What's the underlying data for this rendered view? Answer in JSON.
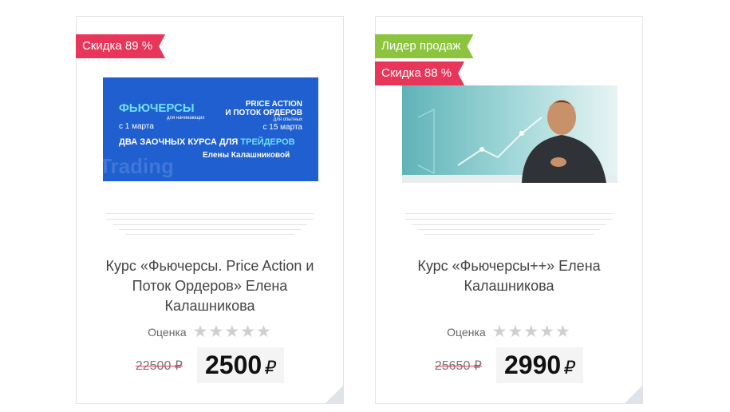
{
  "cards": [
    {
      "badges": [
        "Скидка 89 %"
      ],
      "image_text": {
        "left_title": "ФЬЮЧЕРСЫ",
        "left_sub": "для начинающих",
        "left_date": "с 1 марта",
        "right_title1": "PRICE ACTION",
        "right_title2": "И ПОТОК ОРДЕРОВ",
        "right_sub": "для опытных",
        "right_date": "с 15 марта",
        "headline_a": "ДВА ЗАОЧНЫХ КУРСА ДЛЯ ",
        "headline_b": "ТРЕЙДЕРОВ",
        "author": "Елены Калашниковой",
        "watermark": "Trading"
      },
      "title": "Курс «Фьючерсы. Price Action и Поток Ордеров» Елена Калашникова",
      "rating_label": "Оценка",
      "old_price": "22500 ₽",
      "new_price": "2500",
      "currency": "₽"
    },
    {
      "badges": [
        "Лидер продаж",
        "Скидка 88 %"
      ],
      "title": "Курс «Фьючерсы++» Елена Калашникова",
      "rating_label": "Оценка",
      "old_price": "25650 ₽",
      "new_price": "2990",
      "currency": "₽"
    }
  ],
  "colors": {
    "discount_badge": "#e8365a",
    "leader_badge": "#8cc43e",
    "banner_blue": "#1f5fd0",
    "highlight": "#6fe0ff"
  }
}
